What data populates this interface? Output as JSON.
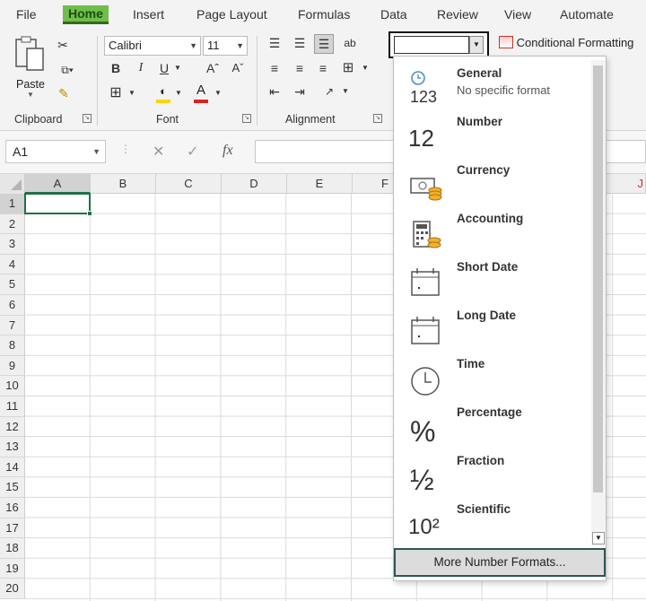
{
  "menu": {
    "tabs": [
      "File",
      "Home",
      "Insert",
      "Page Layout",
      "Formulas",
      "Data",
      "Review",
      "View",
      "Automate"
    ]
  },
  "ribbon": {
    "clipboard": {
      "paste_label": "Paste",
      "group_label": "Clipboard"
    },
    "font": {
      "name": "Calibri",
      "size": "11",
      "bold": "B",
      "italic": "I",
      "underline": "U",
      "grow": "Aˆ",
      "shrink": "Aˇ",
      "font_color_glyph": "A",
      "group_label": "Font"
    },
    "alignment": {
      "group_label": "Alignment"
    },
    "number_format": {
      "value": ""
    },
    "conditional_formatting": "Conditional Formatting"
  },
  "formula_bar": {
    "name_box": "A1",
    "fx": "fx",
    "formula": ""
  },
  "sheet": {
    "columns": [
      "A",
      "B",
      "C",
      "D",
      "E",
      "F",
      "J"
    ],
    "rows": [
      "1",
      "2",
      "3",
      "4",
      "5",
      "6",
      "7",
      "8",
      "9",
      "10",
      "11",
      "12",
      "13",
      "14",
      "15",
      "16",
      "17",
      "18",
      "19",
      "20"
    ],
    "active_cell": "A1"
  },
  "dropdown": {
    "items": [
      {
        "name": "General",
        "sub": "No specific format",
        "icon": "general-icon",
        "icon_text": "123"
      },
      {
        "name": "Number",
        "sub": "",
        "icon": "number-icon",
        "icon_text": "12"
      },
      {
        "name": "Currency",
        "sub": "",
        "icon": "currency-icon",
        "icon_text": ""
      },
      {
        "name": "Accounting",
        "sub": "",
        "icon": "accounting-icon",
        "icon_text": ""
      },
      {
        "name": "Short Date",
        "sub": "",
        "icon": "calendar-icon",
        "icon_text": ""
      },
      {
        "name": "Long Date",
        "sub": "",
        "icon": "calendar-icon",
        "icon_text": ""
      },
      {
        "name": "Time",
        "sub": "",
        "icon": "clock-icon",
        "icon_text": ""
      },
      {
        "name": "Percentage",
        "sub": "",
        "icon": "percent-icon",
        "icon_text": "%"
      },
      {
        "name": "Fraction",
        "sub": "",
        "icon": "fraction-icon",
        "icon_text": "½"
      },
      {
        "name": "Scientific",
        "sub": "",
        "icon": "scientific-icon",
        "icon_text": "10²"
      }
    ],
    "more_label": "More Number Formats..."
  },
  "colors": {
    "accent": "#6fbd4b",
    "active_cell": "#1f7145",
    "font_color": "#e02020",
    "highlight": "#ffd400"
  }
}
